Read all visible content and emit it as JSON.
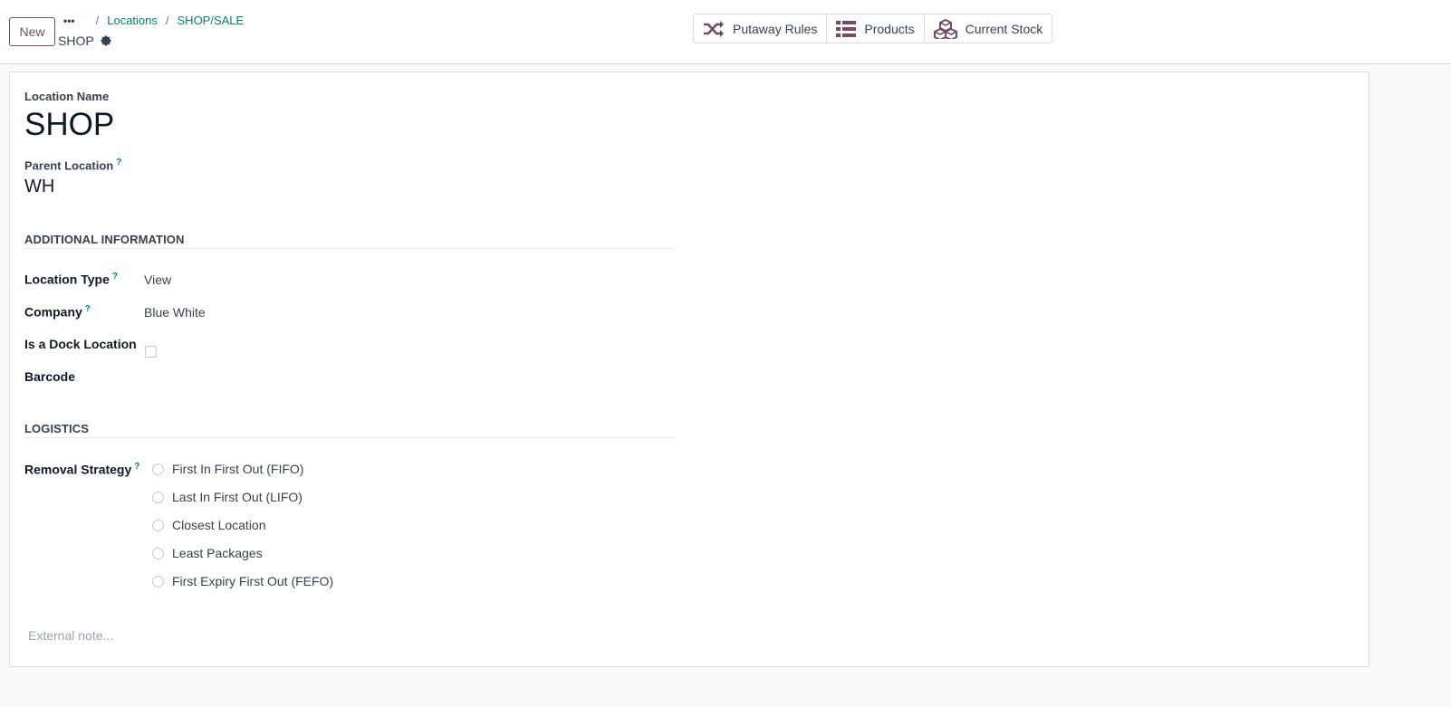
{
  "control_panel": {
    "new_button": "New",
    "breadcrumb": {
      "more": "•••",
      "items": [
        "Locations",
        "SHOP/SALE"
      ],
      "separator": "/"
    },
    "record_title": "SHOP",
    "smart_buttons": [
      {
        "label": "Putaway Rules",
        "icon": "shuffle-icon"
      },
      {
        "label": "Products",
        "icon": "list-icon"
      },
      {
        "label": "Current Stock",
        "icon": "cubes-icon"
      }
    ]
  },
  "form": {
    "location_name_label": "Location Name",
    "location_name": "SHOP",
    "parent_location_label": "Parent Location",
    "parent_location": "WH",
    "help_marker": "?",
    "additional_info": {
      "title": "ADDITIONAL INFORMATION",
      "location_type_label": "Location Type",
      "location_type": "View",
      "company_label": "Company",
      "company": "Blue White",
      "dock_label": "Is a Dock Location",
      "dock_checked": false,
      "barcode_label": "Barcode"
    },
    "logistics": {
      "title": "LOGISTICS",
      "removal_label": "Removal Strategy",
      "options": [
        "First In First Out (FIFO)",
        "Last In First Out (LIFO)",
        "Closest Location",
        "Least Packages",
        "First Expiry First Out (FEFO)"
      ]
    },
    "note_placeholder": "External note..."
  },
  "colors": {
    "brand": "#714b67",
    "link": "#017e84"
  }
}
